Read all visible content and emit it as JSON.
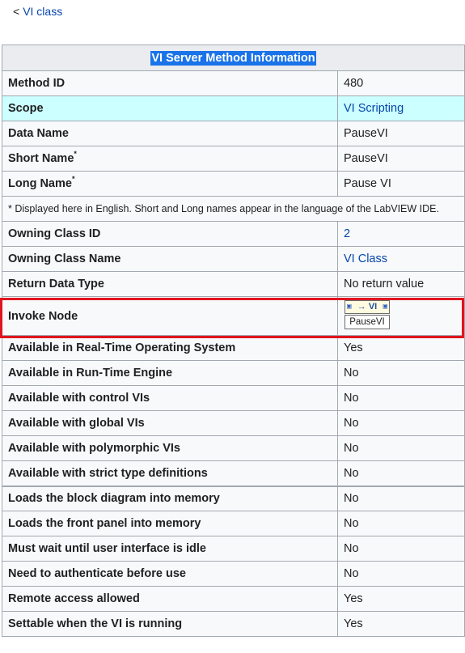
{
  "nav": {
    "back_chevron": "<",
    "back_label": "VI class"
  },
  "table": {
    "title": "VI Server Method Information",
    "rows": [
      {
        "label": "Method ID",
        "value": "480"
      },
      {
        "label": "Scope",
        "value": "VI Scripting"
      },
      {
        "label": "Data Name",
        "value": "PauseVI"
      },
      {
        "label": "Short Name",
        "label_sup": "*",
        "value": "PauseVI"
      },
      {
        "label": "Long Name",
        "label_sup": "*",
        "value": "Pause VI"
      },
      {
        "note": "* Displayed here in English. Short and Long names appear in the language of the LabVIEW IDE."
      },
      {
        "label": "Owning Class ID",
        "value": "2"
      },
      {
        "label": "Owning Class Name",
        "value": "VI Class"
      },
      {
        "label": "Return Data Type",
        "value": "No return value"
      },
      {
        "label": "Invoke Node",
        "node_top": "VI",
        "node_name": "PauseVI",
        "node_arrow": "→"
      },
      {
        "label": "Available in Real-Time Operating System",
        "value": "Yes"
      },
      {
        "label": "Available in Run-Time Engine",
        "value": "No"
      },
      {
        "label": "Available with control VIs",
        "value": "No"
      },
      {
        "label": "Available with global VIs",
        "value": "No"
      },
      {
        "label": "Available with polymorphic VIs",
        "value": "No"
      },
      {
        "label": "Available with strict type definitions",
        "value": "No"
      },
      {
        "label": "Loads the block diagram into memory",
        "value": "No"
      },
      {
        "label": "Loads the front panel into memory",
        "value": "No"
      },
      {
        "label": "Must wait until user interface is idle",
        "value": "No"
      },
      {
        "label": "Need to authenticate before use",
        "value": "No"
      },
      {
        "label": "Remote access allowed",
        "value": "Yes"
      },
      {
        "label": "Settable when the VI is running",
        "value": "Yes"
      }
    ]
  },
  "colors": {
    "link": "#0645ad",
    "scope_bg": "#ccffff",
    "highlight_border": "#e0141e",
    "title_highlight": "#1a73e8"
  }
}
